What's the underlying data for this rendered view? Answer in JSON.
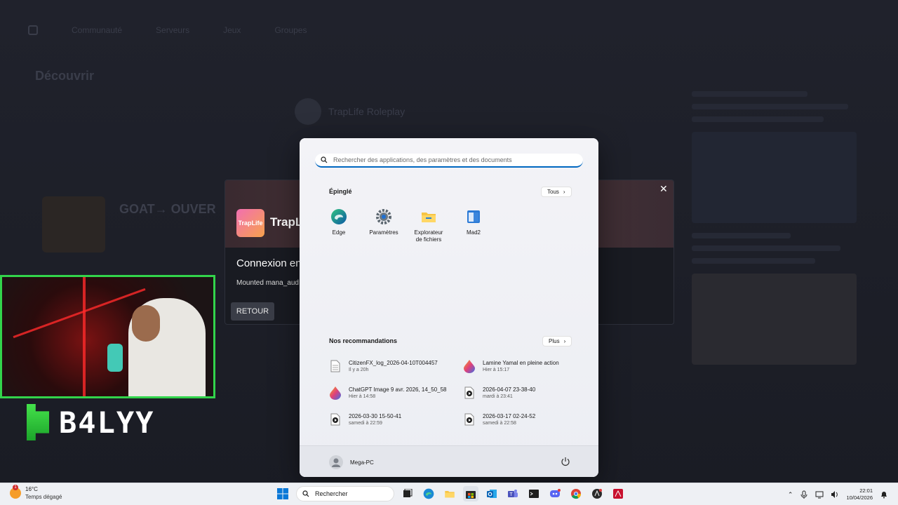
{
  "background": {
    "nav_items": [
      "Communauté",
      "Serveurs",
      "Jeux",
      "Groupes"
    ],
    "page_title": "Découvrir",
    "server_name": "TrapLife Roleplay",
    "goat_title": "GOAT→ OUVER"
  },
  "dialog": {
    "logo_text": "TrapLife",
    "name": "TrapL",
    "heading": "Connexion en",
    "status": "Mounted mana_aud",
    "back_label": "RETOUR",
    "close_label": "✕"
  },
  "webcam": {
    "streamer_name": "B4LYY"
  },
  "start_menu": {
    "search_placeholder": "Rechercher des applications, des paramètres et des documents",
    "pinned_title": "Épinglé",
    "all_label": "Tous",
    "pinned_apps": [
      {
        "label": "Edge",
        "icon": "edge-icon"
      },
      {
        "label": "Paramètres",
        "icon": "settings-gear-icon"
      },
      {
        "label": "Explorateur de fichiers",
        "icon": "folder-icon"
      },
      {
        "label": "Mad2",
        "icon": "app-window-icon"
      }
    ],
    "recommended_title": "Nos recommandations",
    "more_label": "Plus",
    "recommendations": [
      {
        "title": "CitizenFX_log_2026-04-10T004457",
        "subtitle": "Il y a 20h",
        "icon": "document-icon"
      },
      {
        "title": "Lamine Yamal en pleine action",
        "subtitle": "Hier à 15:17",
        "icon": "paint-drop-icon"
      },
      {
        "title": "ChatGPT Image 9 avr. 2026, 14_50_58",
        "subtitle": "Hier à 14:58",
        "icon": "paint-drop-icon"
      },
      {
        "title": "2026-04-07 23-38-40",
        "subtitle": "mardi à 23:41",
        "icon": "video-icon"
      },
      {
        "title": "2026-03-30 15-50-41",
        "subtitle": "samedi à 22:59",
        "icon": "video-icon"
      },
      {
        "title": "2026-03-17 02-24-52",
        "subtitle": "samedi à 22:58",
        "icon": "video-icon"
      }
    ],
    "user_name": "Mega-PC"
  },
  "taskbar": {
    "weather_temp": "16°C",
    "weather_desc": "Temps dégagé",
    "weather_badge": "1",
    "search_label": "Rechercher",
    "time": "22:01",
    "date": "10/04/2026"
  },
  "colors": {
    "accent": "#0067c0",
    "webcam_border": "#32d44b",
    "brand_green": "#44e24b"
  }
}
